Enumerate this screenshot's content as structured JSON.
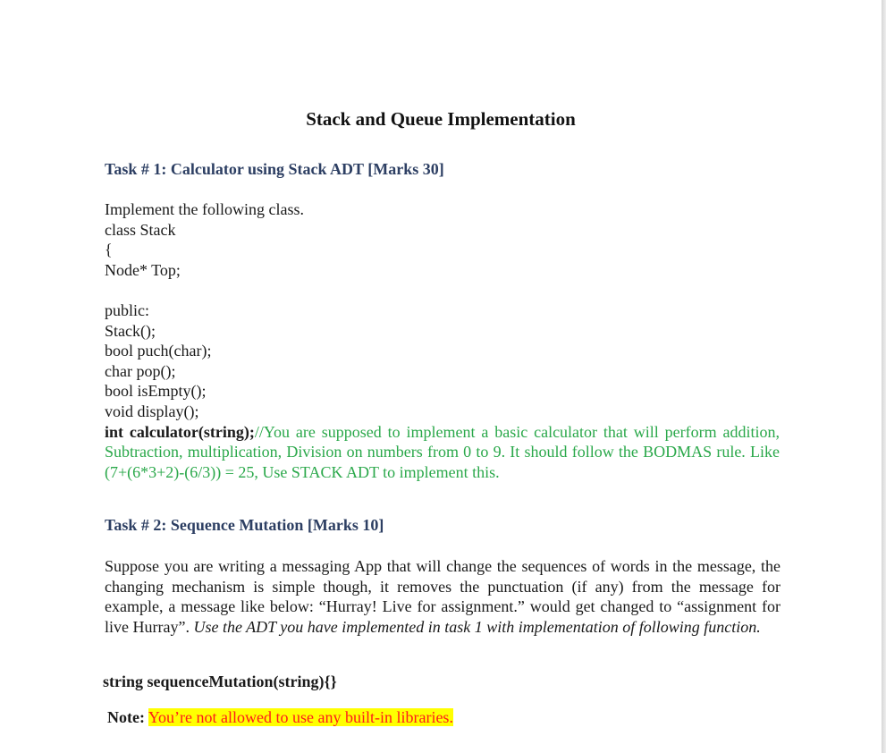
{
  "title": "Stack and Queue Implementation",
  "task1": {
    "heading": "Task # 1: Calculator using Stack ADT [Marks 30]",
    "intro": "Implement the following class.",
    "class_decl": "class Stack",
    "open_brace": "{",
    "member": "Node* Top;",
    "public_label": "public:",
    "methods": [
      "Stack();",
      "bool puch(char);",
      "char pop();",
      "bool isEmpty();",
      "void display();"
    ],
    "calc_signature": "int calculator(string);",
    "calc_comment": "//You are supposed to implement a basic calculator that will perform addition, Subtraction, multiplication, Division on numbers from 0 to 9. It should follow the BODMAS rule. Like  (7+(6*3+2)-(6/3)) = 25, Use STACK ADT to implement this."
  },
  "task2": {
    "heading": "Task # 2: Sequence Mutation [Marks 10]",
    "body": "Suppose you are writing a messaging App that will change the sequences of words in the message, the changing mechanism is simple though, it removes the punctuation (if any) from the message for example, a message like below: “Hurray! Live for assignment.” would get changed to “assignment for live Hurray”. ",
    "body_italic": "Use the ADT you have implemented in task 1 with implementation of following function.",
    "signature": "string sequenceMutation(string){}"
  },
  "note": {
    "label": "Note:",
    "text": "You’re not allowed to use any built-in libraries."
  },
  "colors": {
    "heading": "#2d3f63",
    "comment": "#2aa84a",
    "highlight": "#ffff00",
    "note_text": "#ff1a1a"
  }
}
